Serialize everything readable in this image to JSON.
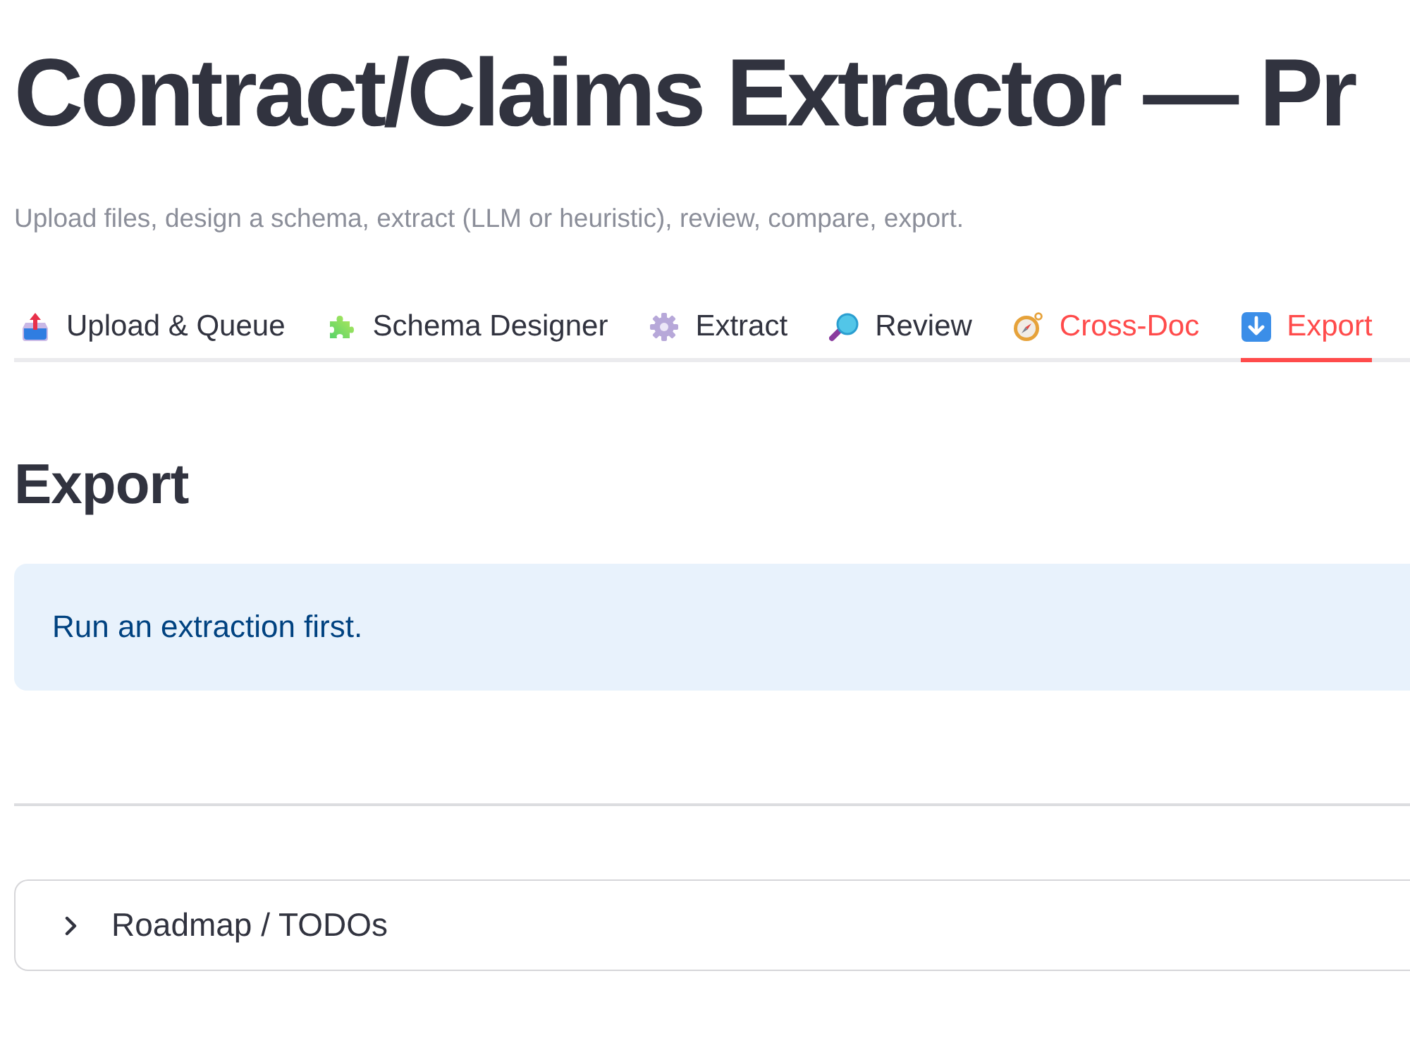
{
  "header": {
    "title": "Contract/Claims Extractor — Pr",
    "caption": "Upload files, design a schema, extract (LLM or heuristic), review, compare, export."
  },
  "tabs": [
    {
      "label": "Upload & Queue",
      "selected": false,
      "hovered": false
    },
    {
      "label": "Schema Designer",
      "selected": false,
      "hovered": false
    },
    {
      "label": "Extract",
      "selected": false,
      "hovered": false
    },
    {
      "label": "Review",
      "selected": false,
      "hovered": false
    },
    {
      "label": "Cross-Doc",
      "selected": false,
      "hovered": true
    },
    {
      "label": "Export",
      "selected": true,
      "hovered": false
    }
  ],
  "section": {
    "heading": "Export",
    "info": "Run an extraction first."
  },
  "expander": {
    "label": "Roadmap / TODOs",
    "expanded": false
  }
}
